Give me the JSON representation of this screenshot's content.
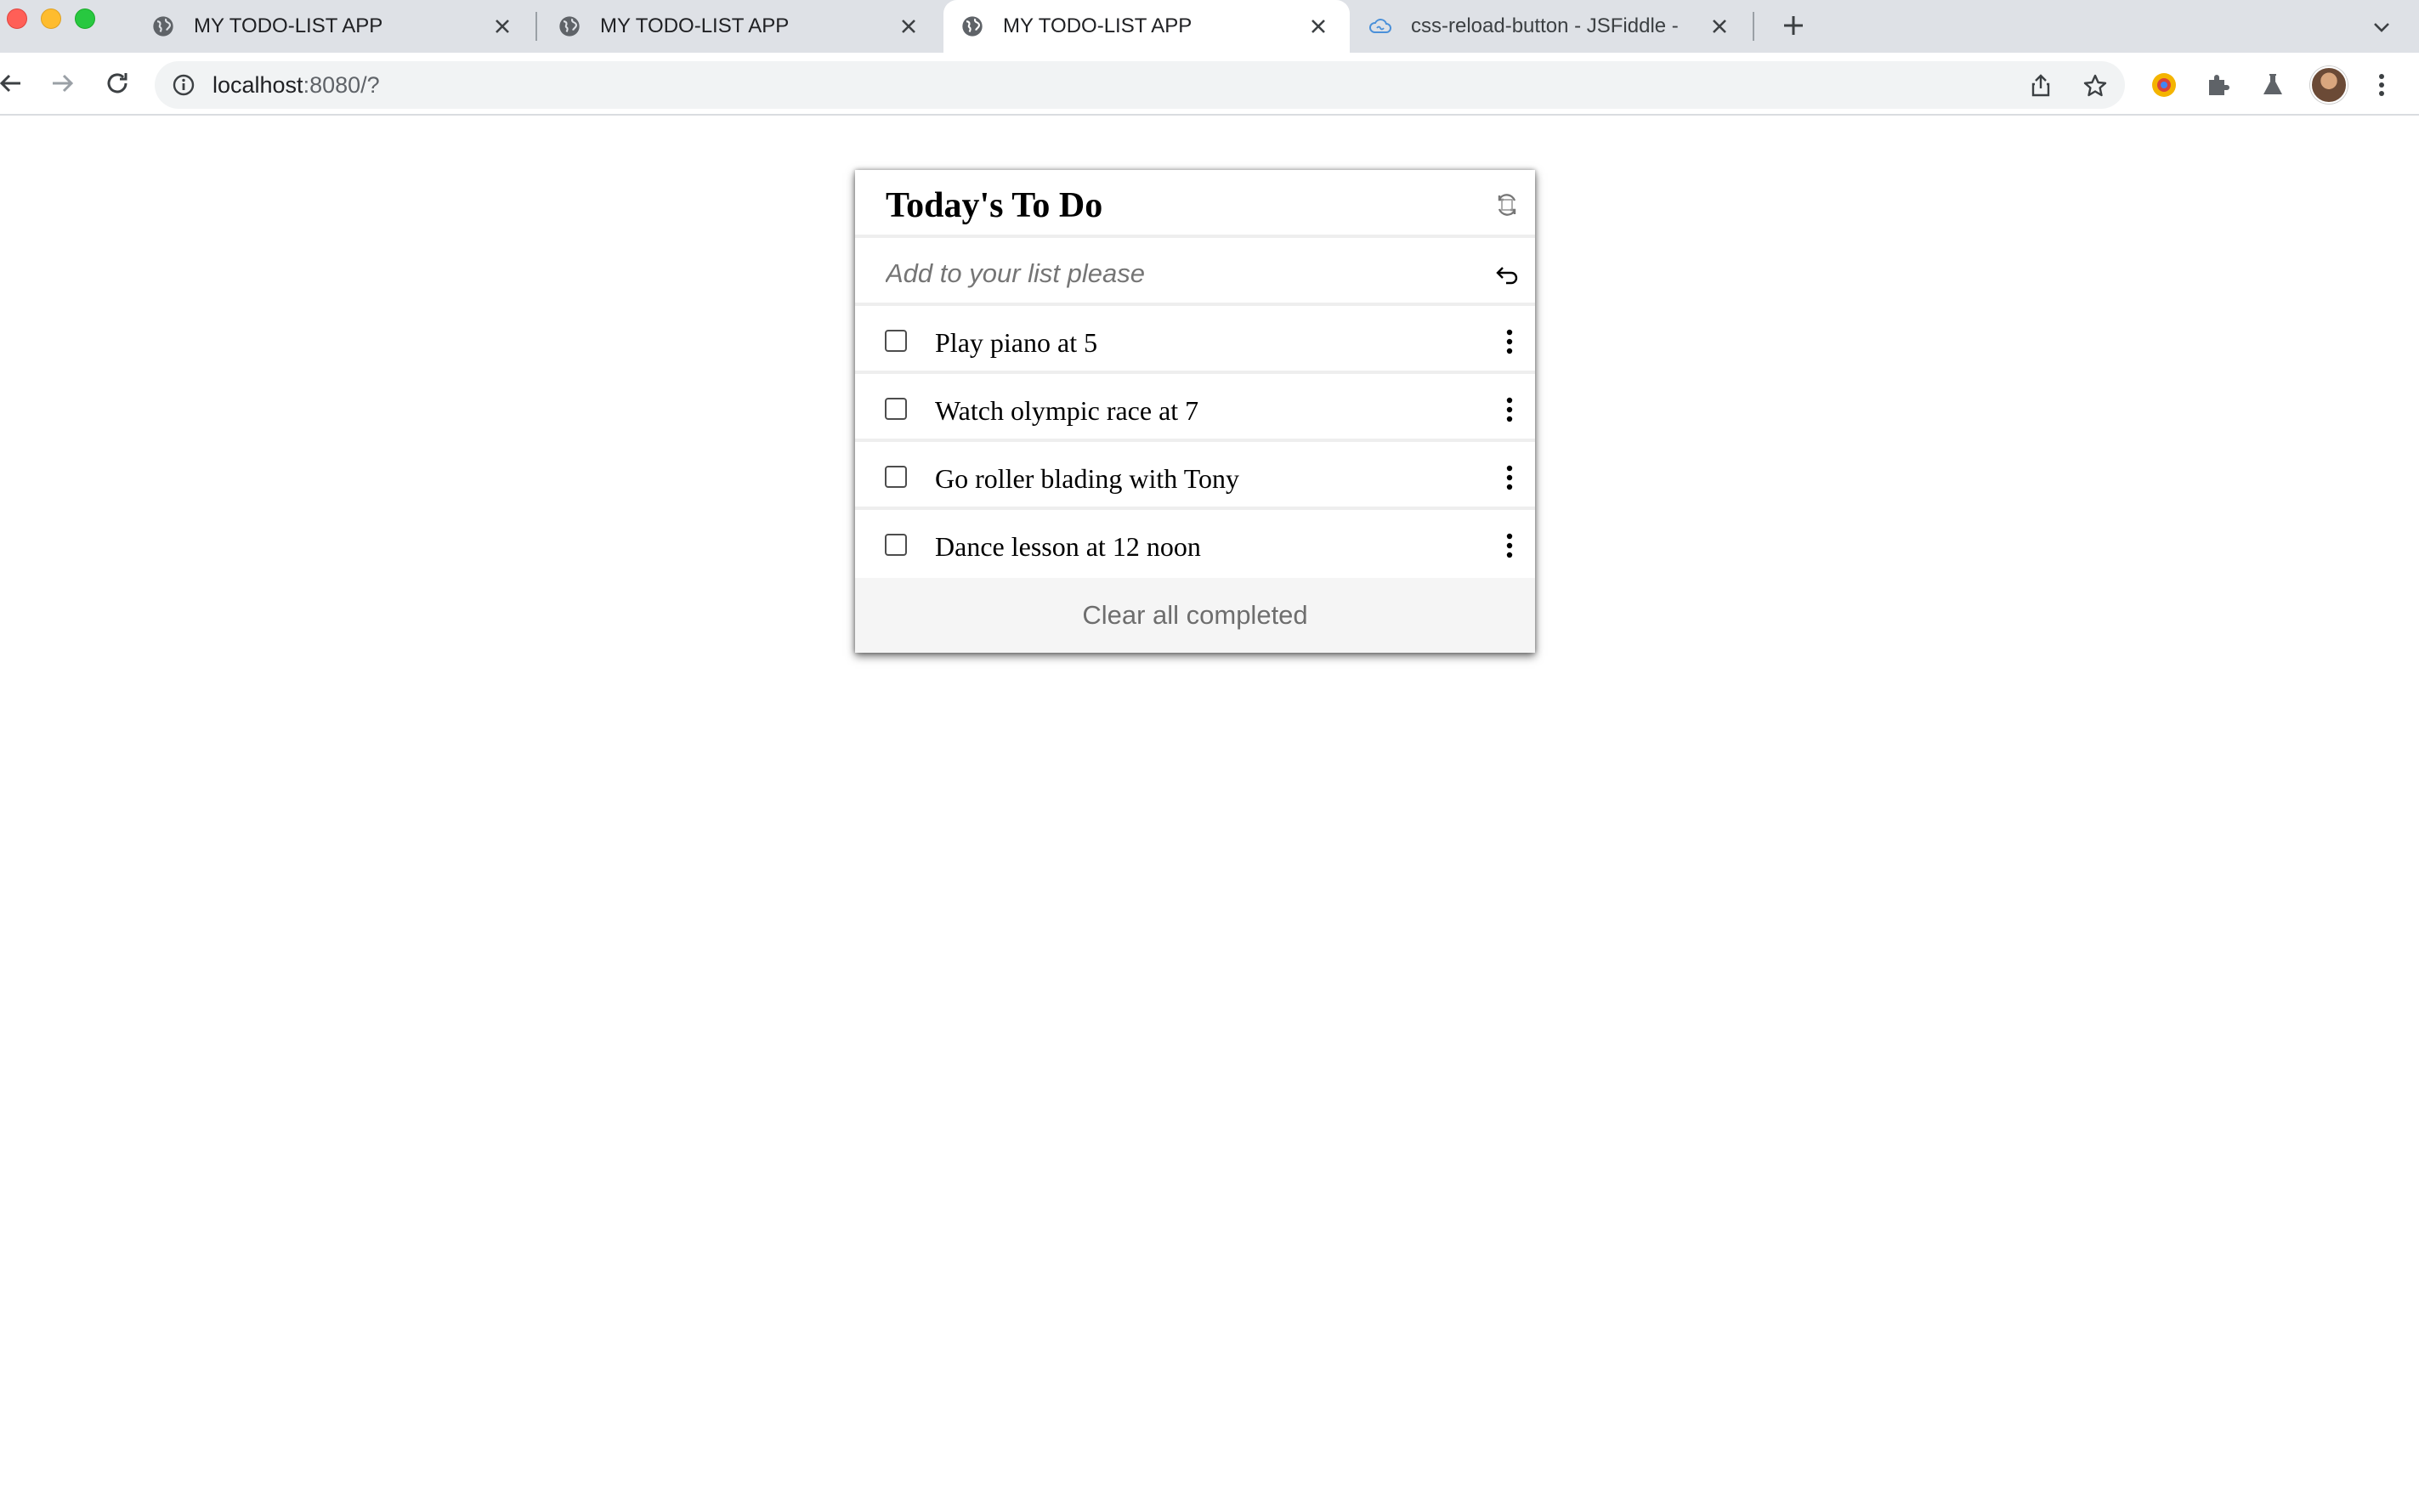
{
  "browser": {
    "tabs": [
      {
        "title": "MY TODO-LIST APP",
        "favicon": "globe-icon",
        "active": false
      },
      {
        "title": "MY TODO-LIST APP",
        "favicon": "globe-icon",
        "active": false
      },
      {
        "title": "MY TODO-LIST APP",
        "favicon": "globe-icon",
        "active": true
      },
      {
        "title": "css-reload-button - JSFiddle -",
        "favicon": "jsfiddle-cloud-icon",
        "active": false
      }
    ],
    "url": {
      "host": "localhost",
      "rest": ":8080/?"
    }
  },
  "app": {
    "title": "Today's To Do",
    "add_placeholder": "Add to your list please",
    "todos": [
      {
        "text": "Play piano at 5",
        "done": false
      },
      {
        "text": "Watch olympic race at 7",
        "done": false
      },
      {
        "text": "Go roller blading with Tony",
        "done": false
      },
      {
        "text": "Dance lesson at 12 noon",
        "done": false
      }
    ],
    "clear_label": "Clear all completed"
  },
  "colors": {
    "tabstrip_bg": "#dee1e6",
    "omnibox_bg": "#f1f3f4",
    "divider": "#eeeeee",
    "footer_bg": "#f5f5f5",
    "placeholder": "#757575",
    "clear_text": "#6e6e6e"
  }
}
